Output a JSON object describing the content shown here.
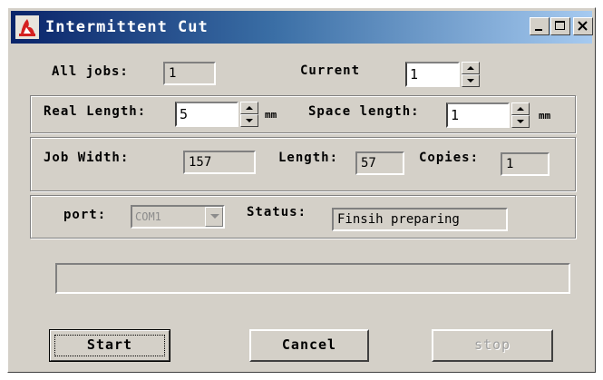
{
  "window": {
    "title": "Intermittent Cut",
    "controls": {
      "minimize": "minimize-icon",
      "maximize": "maximize-icon",
      "close": "close-icon"
    }
  },
  "jobs": {
    "all_jobs_label": "All jobs:",
    "all_jobs_value": "1",
    "current_label": "Current",
    "current_value": "1"
  },
  "length": {
    "real_length_label": "Real Length:",
    "real_length_value": "5",
    "real_length_unit": "mm",
    "space_length_label": "Space length:",
    "space_length_value": "1",
    "space_length_unit": "mm"
  },
  "job": {
    "width_label": "Job Width:",
    "width_value": "157",
    "length_label": "Length:",
    "length_value": "57",
    "copies_label": "Copies:",
    "copies_value": "1"
  },
  "connection": {
    "port_label": "port:",
    "port_value": "COM1",
    "status_label": "Status:",
    "status_value": "Finsih preparing"
  },
  "progress": {
    "value_percent": 0
  },
  "buttons": {
    "start": "Start",
    "cancel": "Cancel",
    "stop": "stop"
  },
  "colors": {
    "titlebar_start": "#0a246a",
    "titlebar_end": "#a6caf0",
    "dialog_face": "#d4d0c8",
    "app_icon": "#d42020"
  }
}
